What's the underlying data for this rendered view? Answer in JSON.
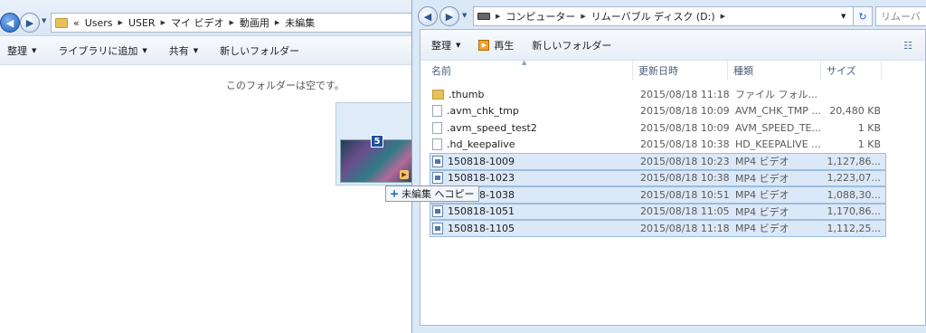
{
  "left_window": {
    "breadcrumb": [
      "«",
      "Users",
      "USER",
      "マイ ビデオ",
      "動画用",
      "未編集"
    ],
    "toolbar": {
      "organize": "整理",
      "add_to_library": "ライブラリに追加",
      "share": "共有",
      "new_folder": "新しいフォルダー"
    },
    "empty_message": "このフォルダーは空です。"
  },
  "drag": {
    "count": "5",
    "tooltip": "未編集 へコピー"
  },
  "right_window": {
    "breadcrumb": [
      "コンピューター",
      "リムーバブル ディスク (D:)"
    ],
    "search_placeholder": "リムーバ",
    "toolbar": {
      "organize": "整理",
      "play": "再生",
      "new_folder": "新しいフォルダー"
    },
    "columns": {
      "name": "名前",
      "date": "更新日時",
      "type": "種類",
      "size": "サイズ"
    },
    "files": [
      {
        "icon": "folder-icon",
        "name": ".thumb",
        "date": "2015/08/18 11:18",
        "type": "ファイル フォル...",
        "size": "",
        "selected": false
      },
      {
        "icon": "file-icon",
        "name": ".avm_chk_tmp",
        "date": "2015/08/18 10:09",
        "type": "AVM_CHK_TMP ...",
        "size": "20,480 KB",
        "selected": false
      },
      {
        "icon": "file-icon",
        "name": ".avm_speed_test2",
        "date": "2015/08/18 10:09",
        "type": "AVM_SPEED_TE...",
        "size": "1 KB",
        "selected": false
      },
      {
        "icon": "file-icon",
        "name": ".hd_keepalive",
        "date": "2015/08/18 10:38",
        "type": "HD_KEEPALIVE ...",
        "size": "1 KB",
        "selected": false
      },
      {
        "icon": "video-icon",
        "name": "150818-1009",
        "date": "2015/08/18 10:23",
        "type": "MP4 ビデオ",
        "size": "1,127,86...",
        "selected": true
      },
      {
        "icon": "video-icon",
        "name": "150818-1023",
        "date": "2015/08/18 10:38",
        "type": "MP4 ビデオ",
        "size": "1,223,07...",
        "selected": true
      },
      {
        "icon": "video-icon",
        "name": "150818-1038",
        "date": "2015/08/18 10:51",
        "type": "MP4 ビデオ",
        "size": "1,088,30...",
        "selected": true
      },
      {
        "icon": "video-icon",
        "name": "150818-1051",
        "date": "2015/08/18 11:05",
        "type": "MP4 ビデオ",
        "size": "1,170,86...",
        "selected": true
      },
      {
        "icon": "video-icon",
        "name": "150818-1105",
        "date": "2015/08/18 11:18",
        "type": "MP4 ビデオ",
        "size": "1,112,25...",
        "selected": true
      }
    ]
  }
}
